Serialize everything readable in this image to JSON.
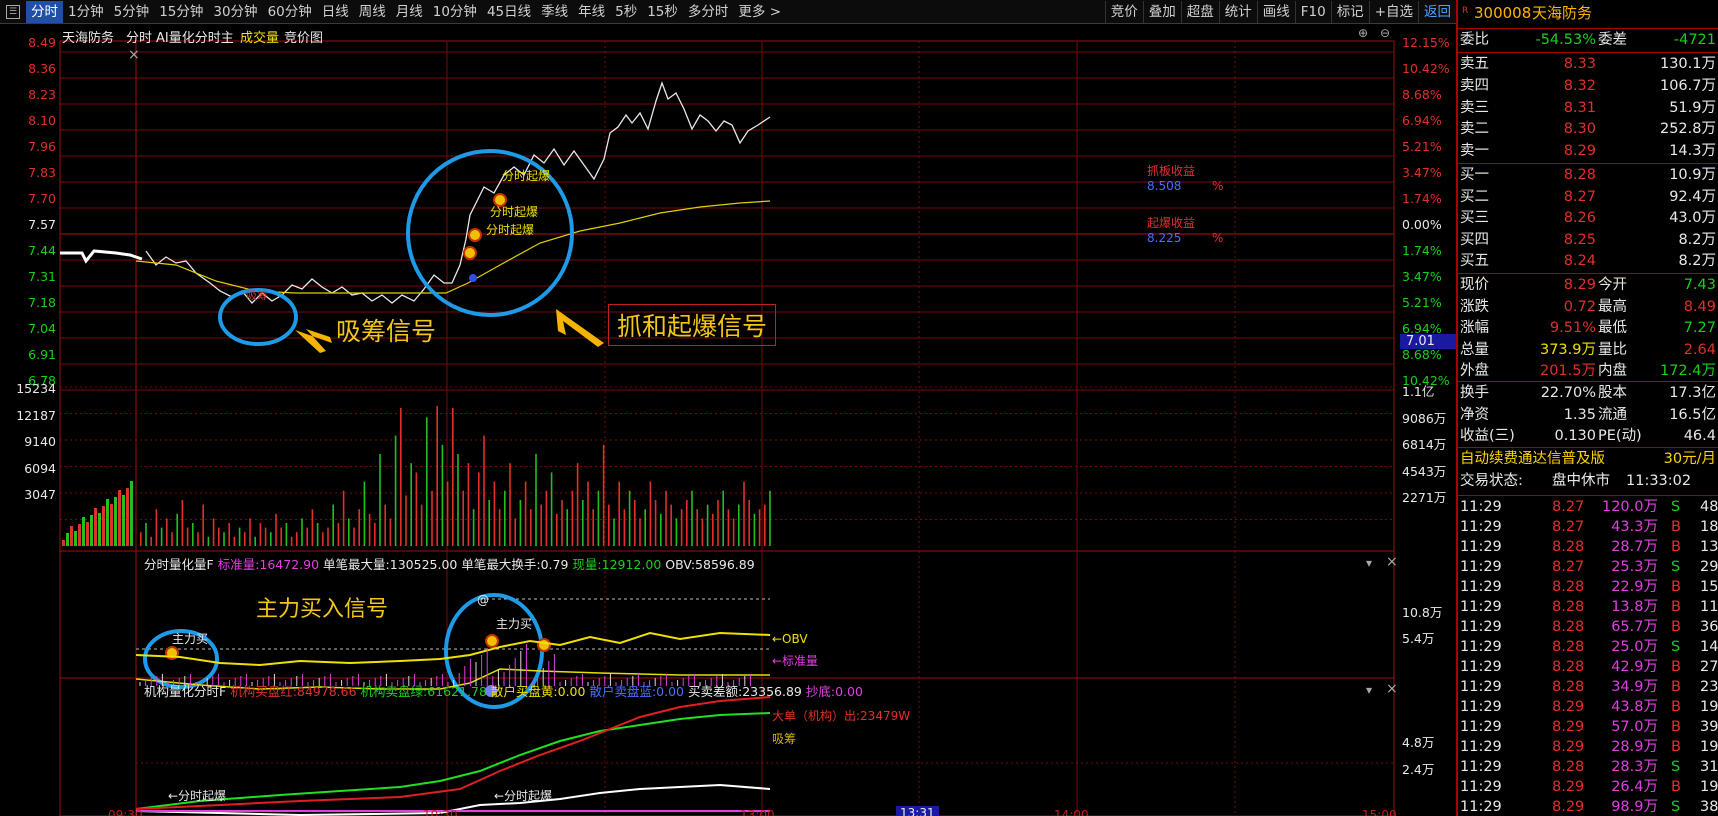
{
  "toolbar": {
    "periods": [
      "分时",
      "1分钟",
      "5分钟",
      "15分钟",
      "30分钟",
      "60分钟",
      "日线",
      "周线",
      "月线",
      "10分钟",
      "45日线",
      "季线",
      "年线",
      "5秒",
      "15秒",
      "多分时",
      "更多 >"
    ],
    "tools": [
      "竞价",
      "叠加",
      "超盘",
      "统计",
      "画线",
      "F10",
      "标记",
      "+自选",
      "返回"
    ]
  },
  "chart": {
    "header": {
      "stock": "天海防务",
      "mode": "分时",
      "ai": "AI量化分时主",
      "volume": "成交量",
      "auction": "竞价图"
    },
    "price_axis_left": [
      "8.49",
      "8.36",
      "8.23",
      "8.10",
      "7.96",
      "7.83",
      "7.70",
      "7.57",
      "7.44",
      "7.31",
      "7.18",
      "7.04",
      "6.91",
      "6.78"
    ],
    "pct_axis_right": [
      "12.15%",
      "10.42%",
      "8.68%",
      "6.94%",
      "5.21%",
      "3.47%",
      "1.74%",
      "0.00%",
      "1.74%",
      "3.47%",
      "5.21%",
      "6.94%",
      "8.68%",
      "10.42%"
    ],
    "current_price_tag": "7.01",
    "vol_axis_left": [
      "15234",
      "12187",
      "9140",
      "6094",
      "3047"
    ],
    "vol_axis_right": [
      "1.1亿",
      "9086万",
      "6814万",
      "4543万",
      "2271万"
    ],
    "time_axis": [
      "09:30",
      "10:30",
      "13:00",
      "13:31",
      "14:00",
      "15:00"
    ],
    "annotations": {
      "xichou_text": "吸筹",
      "xichou_signal": "吸筹信号",
      "qibao_signal": "抓和起爆信号",
      "qibao_labels": [
        "分时起爆",
        "分时起爆",
        "分时起爆"
      ],
      "zhualban_title": "抓板收益",
      "zhuaban_value": "8.508",
      "zhuaban_unit": "%",
      "qibao_title": "起爆收益",
      "qibao_value": "8.225",
      "qibao_unit": "%"
    },
    "indicator1": {
      "name": "分时量化量F",
      "std_label": "标准量:",
      "std_value": "16472.90",
      "max_label": "单笔最大量:",
      "max_value": "130525.00",
      "turn_label": "单笔最大换手:",
      "turn_value": "0.79",
      "now_label": "现量:",
      "now_value": "12912.00",
      "obv_label": "OBV:",
      "obv_value": "58596.89",
      "axis": [
        "10.8万",
        "5.4万"
      ],
      "signal": "主力买入信号",
      "buy_label": "主力买",
      "obv_tag": "←OBV",
      "std_tag": "←标准量",
      "at": "@"
    },
    "indicator2": {
      "name": "机构量化分时F",
      "inst_buy_label": "机构买盘红:",
      "inst_buy_value": "84978.66",
      "inst_sell_label": "机构卖盘绿:",
      "inst_sell_value": "61621.78",
      "retail_buy_label": "散户买盘黄:",
      "retail_buy_value": "0.00",
      "retail_sell_label": "散户卖盘蓝:",
      "retail_sell_value": "0.00",
      "diff_label": "买卖差额:",
      "diff_value": "23356.89",
      "bottom_label": "抄底:",
      "bottom_value": "0.00",
      "axis": [
        "4.8万",
        "2.4万"
      ],
      "big_order": "大单（机构）出:23479W",
      "xichou": "吸筹",
      "qibao_tag1": "←分时起爆",
      "qibao_tag2": "←分时起爆"
    }
  },
  "panel": {
    "code": "300008",
    "name": "天海防务",
    "badge": "R",
    "weibi_label": "委比",
    "weibi": "-54.53%",
    "weicha_label": "委差",
    "weicha": "-4721",
    "asks": [
      {
        "label": "卖五",
        "price": "8.33",
        "vol": "130.1万"
      },
      {
        "label": "卖四",
        "price": "8.32",
        "vol": "106.7万"
      },
      {
        "label": "卖三",
        "price": "8.31",
        "vol": "51.9万"
      },
      {
        "label": "卖二",
        "price": "8.30",
        "vol": "252.8万"
      },
      {
        "label": "卖一",
        "price": "8.29",
        "vol": "14.3万"
      }
    ],
    "bids": [
      {
        "label": "买一",
        "price": "8.28",
        "vol": "10.9万"
      },
      {
        "label": "买二",
        "price": "8.27",
        "vol": "92.4万"
      },
      {
        "label": "买三",
        "price": "8.26",
        "vol": "43.0万"
      },
      {
        "label": "买四",
        "price": "8.25",
        "vol": "8.2万"
      },
      {
        "label": "买五",
        "price": "8.24",
        "vol": "8.2万"
      }
    ],
    "stats": [
      {
        "l1": "现价",
        "v1": "8.29",
        "l2": "今开",
        "v2": "7.43"
      },
      {
        "l1": "涨跌",
        "v1": "0.72",
        "l2": "最高",
        "v2": "8.49"
      },
      {
        "l1": "涨幅",
        "v1": "9.51%",
        "l2": "最低",
        "v2": "7.27"
      },
      {
        "l1": "总量",
        "v1": "373.9万",
        "l2": "量比",
        "v2": "2.64"
      },
      {
        "l1": "外盘",
        "v1": "201.5万",
        "l2": "内盘",
        "v2": "172.4万"
      }
    ],
    "fund": [
      {
        "l1": "换手",
        "v1": "22.70%",
        "l2": "股本",
        "v2": "17.3亿"
      },
      {
        "l1": "净资",
        "v1": "1.35",
        "l2": "流通",
        "v2": "16.5亿"
      },
      {
        "l1": "收益(三)",
        "v1": "0.130",
        "l2": "PE(动)",
        "v2": "46.4"
      }
    ],
    "ad": "自动续费通达信普及版",
    "ad_price": "30元/月",
    "status_label": "交易状态:",
    "status": "盘中休市",
    "status_time": "11:33:02",
    "ticks": [
      {
        "t": "11:29",
        "p": "8.27",
        "v": "120.0万",
        "d": "S",
        "n": "48"
      },
      {
        "t": "11:29",
        "p": "8.27",
        "v": "43.3万",
        "d": "B",
        "n": "18"
      },
      {
        "t": "11:29",
        "p": "8.28",
        "v": "28.7万",
        "d": "B",
        "n": "13"
      },
      {
        "t": "11:29",
        "p": "8.27",
        "v": "25.3万",
        "d": "S",
        "n": "29"
      },
      {
        "t": "11:29",
        "p": "8.28",
        "v": "22.9万",
        "d": "B",
        "n": "15"
      },
      {
        "t": "11:29",
        "p": "8.28",
        "v": "13.8万",
        "d": "B",
        "n": "11"
      },
      {
        "t": "11:29",
        "p": "8.28",
        "v": "65.7万",
        "d": "B",
        "n": "36"
      },
      {
        "t": "11:29",
        "p": "8.28",
        "v": "25.0万",
        "d": "S",
        "n": "14"
      },
      {
        "t": "11:29",
        "p": "8.28",
        "v": "42.9万",
        "d": "B",
        "n": "27"
      },
      {
        "t": "11:29",
        "p": "8.28",
        "v": "34.9万",
        "d": "B",
        "n": "23"
      },
      {
        "t": "11:29",
        "p": "8.29",
        "v": "43.8万",
        "d": "B",
        "n": "19"
      },
      {
        "t": "11:29",
        "p": "8.29",
        "v": "57.0万",
        "d": "B",
        "n": "39"
      },
      {
        "t": "11:29",
        "p": "8.29",
        "v": "28.9万",
        "d": "B",
        "n": "19"
      },
      {
        "t": "11:29",
        "p": "8.28",
        "v": "28.3万",
        "d": "S",
        "n": "31"
      },
      {
        "t": "11:29",
        "p": "8.29",
        "v": "26.4万",
        "d": "B",
        "n": "19"
      },
      {
        "t": "11:29",
        "p": "8.29",
        "v": "98.9万",
        "d": "S",
        "n": "38"
      }
    ]
  }
}
